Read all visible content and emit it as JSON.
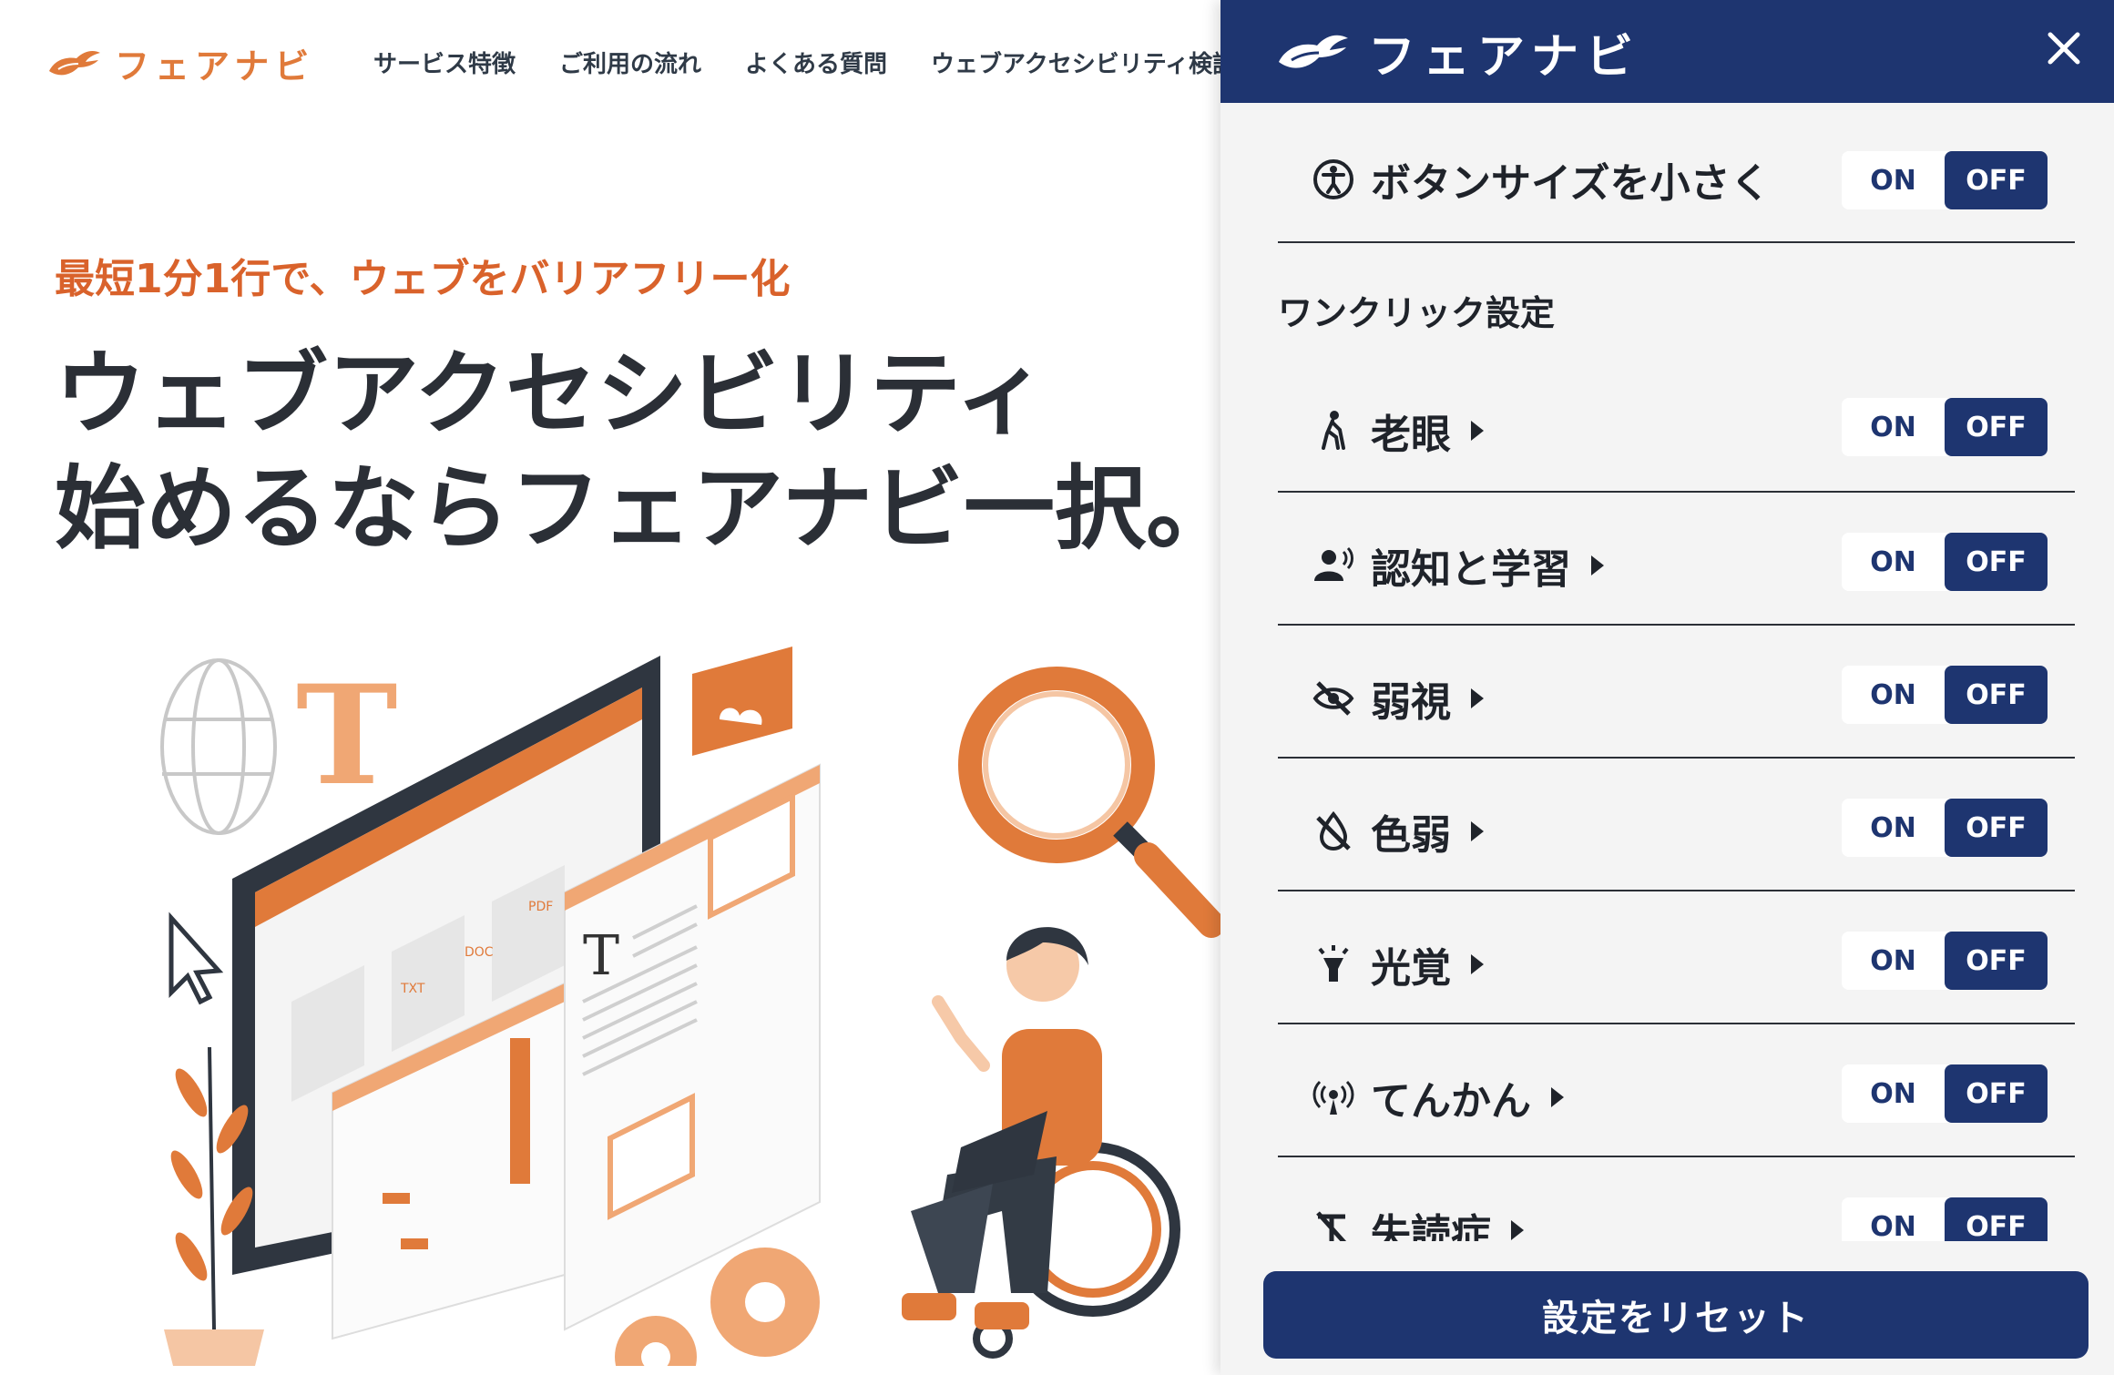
{
  "site": {
    "logo_text": "フェアナビ",
    "nav": [
      "サービス特徴",
      "ご利用の流れ",
      "よくある質問",
      "ウェブアクセシビリティ検証"
    ],
    "tagline": "最短1分1行で、ウェブをバリアフリー化",
    "hero_line1": "ウェブアクセシビリティ",
    "hero_line2": "始めるならフェアナビ一択。",
    "illustration_labels": {
      "txt": "TXT",
      "doc": "DOC",
      "pdf": "PDF",
      "letter": "T"
    }
  },
  "panel": {
    "logo_text": "フェアナビ",
    "close_icon": "close-icon",
    "button_size": {
      "label": "ボタンサイズを小さく",
      "on": "ON",
      "off": "OFF",
      "state": "off",
      "icon": "accessibility-icon"
    },
    "section_title": "ワンクリック設定",
    "presets": [
      {
        "label": "老眼",
        "icon": "elderly-walker-icon",
        "on": "ON",
        "off": "OFF",
        "state": "off"
      },
      {
        "label": "認知と学習",
        "icon": "speaking-person-icon",
        "on": "ON",
        "off": "OFF",
        "state": "off"
      },
      {
        "label": "弱視",
        "icon": "eye-slash-icon",
        "on": "ON",
        "off": "OFF",
        "state": "off"
      },
      {
        "label": "色弱",
        "icon": "color-drop-slash-icon",
        "on": "ON",
        "off": "OFF",
        "state": "off"
      },
      {
        "label": "光覚",
        "icon": "light-bulb-icon",
        "on": "ON",
        "off": "OFF",
        "state": "off"
      },
      {
        "label": "てんかん",
        "icon": "broadcast-icon",
        "on": "ON",
        "off": "OFF",
        "state": "off"
      },
      {
        "label": "失読症",
        "icon": "text-slash-icon",
        "on": "ON",
        "off": "OFF",
        "state": "off"
      }
    ],
    "reset_label": "設定をリセット"
  },
  "colors": {
    "brand_orange": "#e07a3a",
    "tagline_orange": "#d9622b",
    "navy": "#1e3570",
    "panel_bg": "#f4f4f4"
  }
}
